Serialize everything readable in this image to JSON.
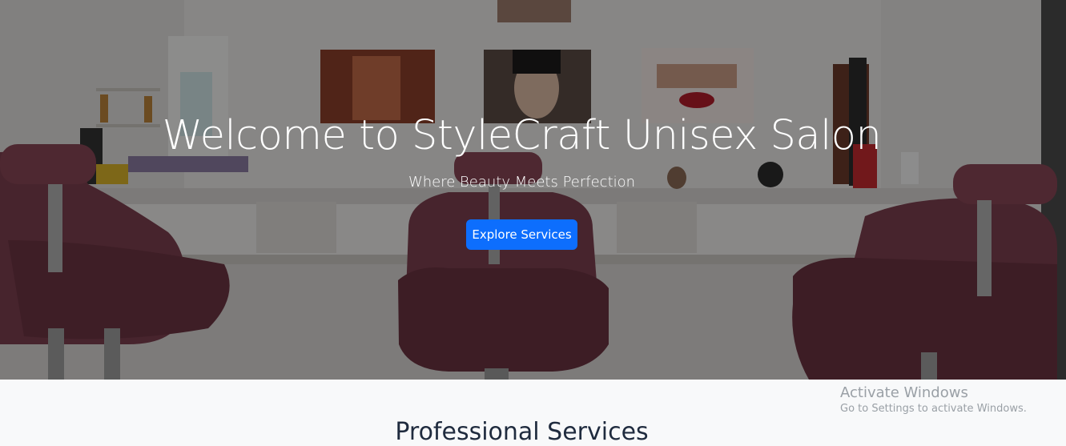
{
  "hero": {
    "title": "Welcome to StyleCraft Unisex Salon",
    "subtitle": "Where Beauty Meets Perfection",
    "cta_label": "Explore Services",
    "cta_color": "#0d6efd"
  },
  "section": {
    "title": "Professional Services"
  },
  "watermark": {
    "title": "Activate Windows",
    "subtitle": "Go to Settings to activate Windows."
  },
  "colors": {
    "section_bg": "#f8f9fa",
    "chair": "#7a3e4e"
  }
}
